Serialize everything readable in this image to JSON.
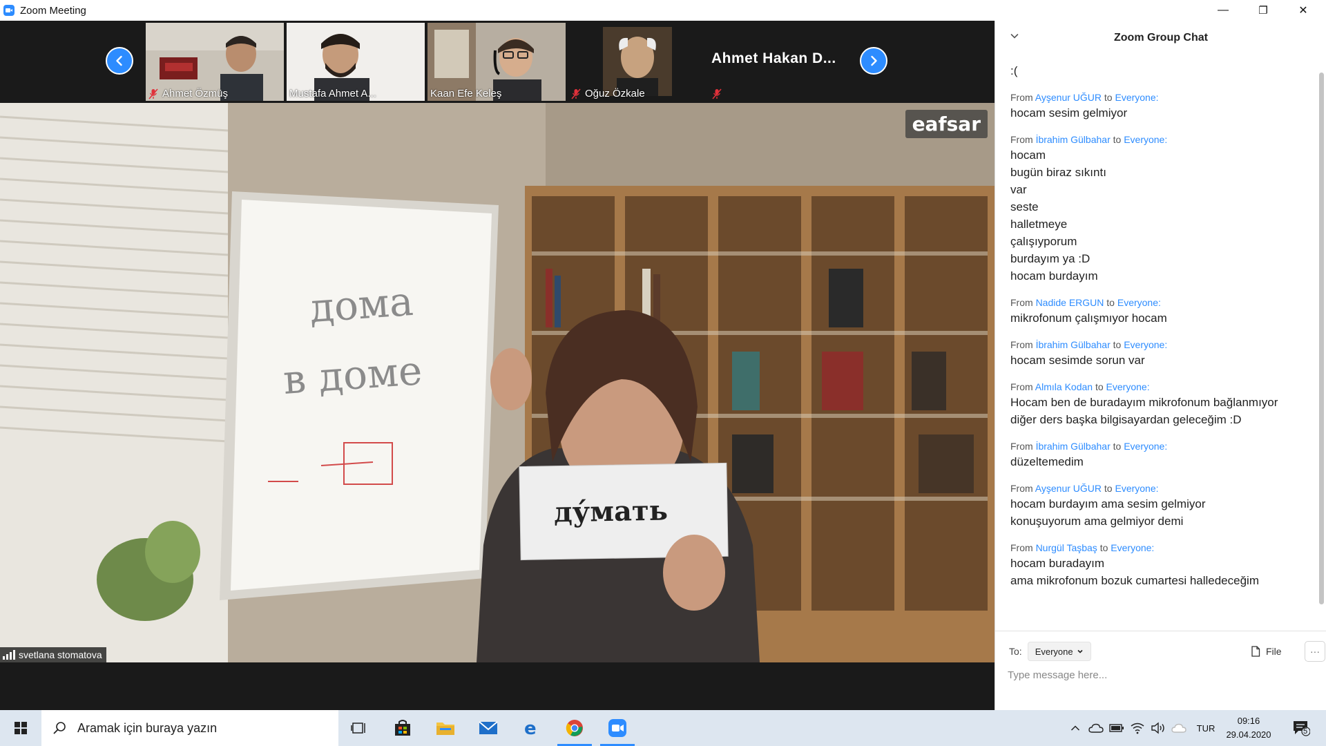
{
  "window": {
    "title": "Zoom Meeting",
    "controls": {
      "minimize": "—",
      "restore": "❐",
      "close": "✕"
    }
  },
  "participants": [
    {
      "name": "Ahmet Özmüş",
      "muted": true
    },
    {
      "name": "Mustafa Ahmet A...",
      "muted": false
    },
    {
      "name": "Kaan Efe Keleş",
      "muted": false
    },
    {
      "name": "Oğuz Özkale",
      "muted": true
    },
    {
      "name": "Ahmet  Hakan  D...",
      "muted": true
    }
  ],
  "video": {
    "speaker_name": "svetlana stomatova",
    "watermark": "eafsar",
    "whiteboard_words": [
      "дома",
      "в доме"
    ],
    "card_word": "ду́мать"
  },
  "chat": {
    "title": "Zoom Group Chat",
    "messages": [
      {
        "from": "",
        "to": "",
        "lines": [
          ":("
        ]
      },
      {
        "from": "Ayşenur UĞUR",
        "to": "Everyone:",
        "lines": [
          "hocam sesim gelmiyor"
        ]
      },
      {
        "from": "İbrahim Gülbahar",
        "to": "Everyone:",
        "lines": [
          "hocam",
          "bugün biraz sıkıntı",
          "var",
          "seste",
          "halletmeye",
          "çalışıyporum",
          "burdayım ya :D",
          "hocam burdayım"
        ]
      },
      {
        "from": "Nadide ERGUN",
        "to": "Everyone:",
        "lines": [
          "mikrofonum çalışmıyor hocam"
        ]
      },
      {
        "from": "İbrahim Gülbahar",
        "to": "Everyone:",
        "lines": [
          "hocam sesimde sorun var"
        ]
      },
      {
        "from": "Almıla Kodan",
        "to": "Everyone:",
        "lines": [
          "Hocam ben de buradayım mikrofonum bağlanmıyor diğer ders başka bilgisayardan geleceğim :D"
        ]
      },
      {
        "from": "İbrahim Gülbahar",
        "to": "Everyone:",
        "lines": [
          "düzeltemedim"
        ]
      },
      {
        "from": "Ayşenur UĞUR",
        "to": "Everyone:",
        "lines": [
          "hocam burdayım ama sesim gelmiyor",
          "konuşuyorum ama gelmiyor demi"
        ]
      },
      {
        "from": "Nurgül Taşbaş",
        "to": "Everyone:",
        "lines": [
          "hocam buradayım",
          "ama mikrofonum bozuk cumartesi halledeceğim"
        ]
      }
    ],
    "from_word": "From",
    "to_word": "to",
    "to_label": "To:",
    "recipient": "Everyone",
    "file_label": "File",
    "more_label": "···",
    "input_placeholder": "Type message here..."
  },
  "taskbar": {
    "search_placeholder": "Aramak için buraya yazın",
    "language": "TUR",
    "time": "09:16",
    "date": "29.04.2020",
    "notification_count": "5"
  }
}
